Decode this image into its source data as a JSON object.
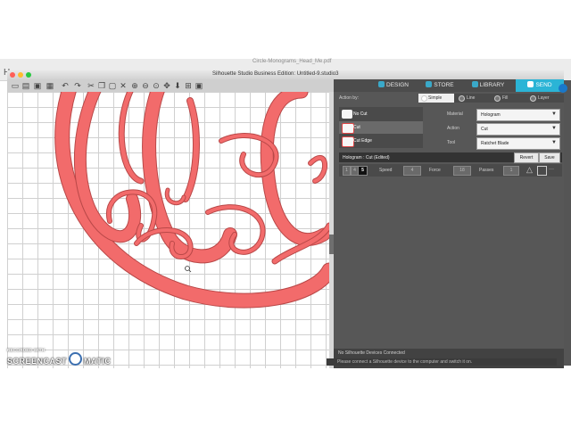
{
  "background_window": {
    "title": "Circle-Monograms_Head_Me.pdf",
    "edge_letter": "H"
  },
  "window": {
    "title": "Silhouette Studio Business Edition: Untitled-9.studio3"
  },
  "nav_tabs": [
    {
      "label": "DESIGN",
      "icon": "design-icon"
    },
    {
      "label": "STORE",
      "icon": "store-icon"
    },
    {
      "label": "LIBRARY",
      "icon": "library-icon"
    },
    {
      "label": "SEND",
      "icon": "send-icon",
      "active": true
    }
  ],
  "toolbar_icons": [
    "new-file-icon",
    "open-folder-icon",
    "save-icon",
    "print-icon",
    "undo-icon",
    "redo-icon",
    "cut-icon",
    "copy-icon",
    "paste-icon",
    "delete-icon",
    "zoom-in-icon",
    "zoom-out-icon",
    "zoom-drag-icon",
    "pan-icon",
    "move-down-icon",
    "zoom-fit-icon",
    "fit-page-icon"
  ],
  "send_panel": {
    "action_by_label": "Action by:",
    "subtabs": [
      "Simple",
      "Line",
      "Fill",
      "Layer"
    ],
    "actions": [
      "No Cut",
      "Cut",
      "Cut Edge"
    ],
    "material": {
      "label": "Material",
      "value": "Hologram"
    },
    "action": {
      "label": "Action",
      "value": "Cut"
    },
    "tool": {
      "label": "Tool",
      "value": "Ratchet Blade"
    },
    "material_row": "Hologram : Cut (Edited)",
    "revert_label": "Revert",
    "save_label": "Save",
    "blade_value": "1",
    "blade_digit": "4",
    "blade_highlight": "5",
    "speed": {
      "label": "Speed",
      "value": "4"
    },
    "force": {
      "label": "Force",
      "value": "18"
    },
    "passes": {
      "label": "Passes",
      "value": "1"
    },
    "status_main": "No Silhouette Devices Connected",
    "status_sub": "Please connect a Silhouette device to the computer and switch it on."
  },
  "watermark": {
    "line1": "RECORDED WITH",
    "brand_a": "SCREENCAST",
    "brand_b": "MATIC"
  },
  "colors": {
    "monogram": "#f26b6b",
    "outline": "#b94848",
    "send_accent": "#2bb4d6"
  }
}
